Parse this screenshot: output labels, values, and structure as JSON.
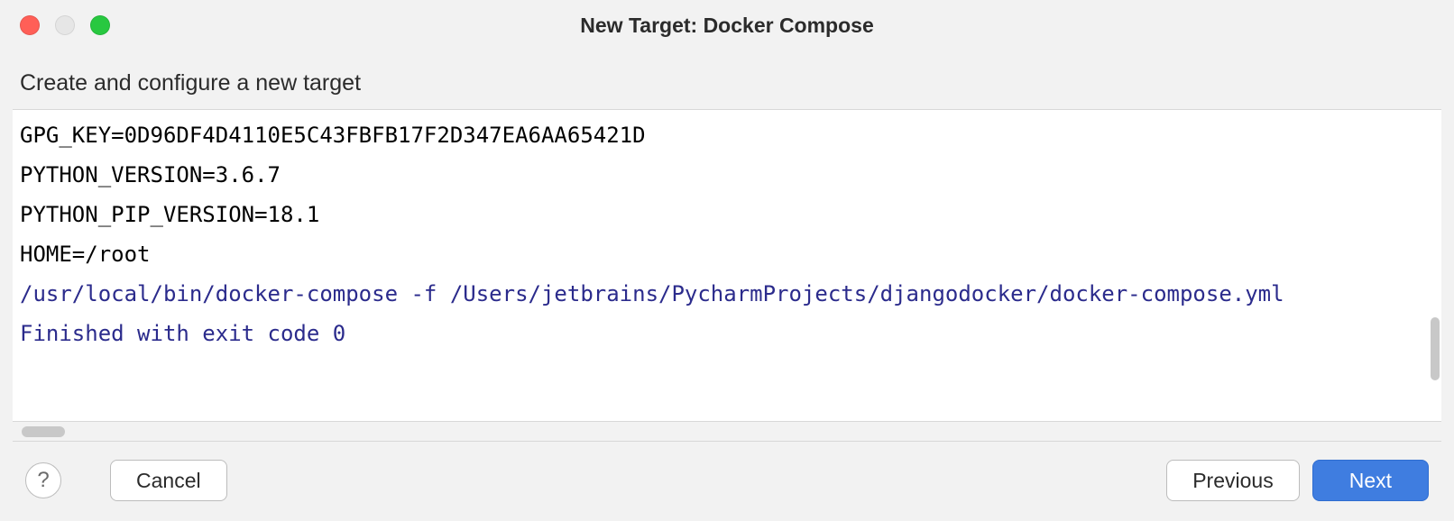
{
  "window": {
    "title": "New Target: Docker Compose",
    "subtitle": "Create and configure a new target"
  },
  "console": {
    "lines": [
      {
        "text": "GPG_KEY=0D96DF4D4110E5C43FBFB17F2D347EA6AA65421D",
        "style": "plain"
      },
      {
        "text": "PYTHON_VERSION=3.6.7",
        "style": "plain"
      },
      {
        "text": "PYTHON_PIP_VERSION=18.1",
        "style": "plain"
      },
      {
        "text": "HOME=/root",
        "style": "plain"
      },
      {
        "text": "/usr/local/bin/docker-compose -f /Users/jetbrains/PycharmProjects/djangodocker/docker-compose.yml",
        "style": "blue"
      },
      {
        "text": "Finished with exit code 0",
        "style": "blue"
      }
    ]
  },
  "footer": {
    "help_label": "?",
    "cancel_label": "Cancel",
    "previous_label": "Previous",
    "next_label": "Next"
  }
}
